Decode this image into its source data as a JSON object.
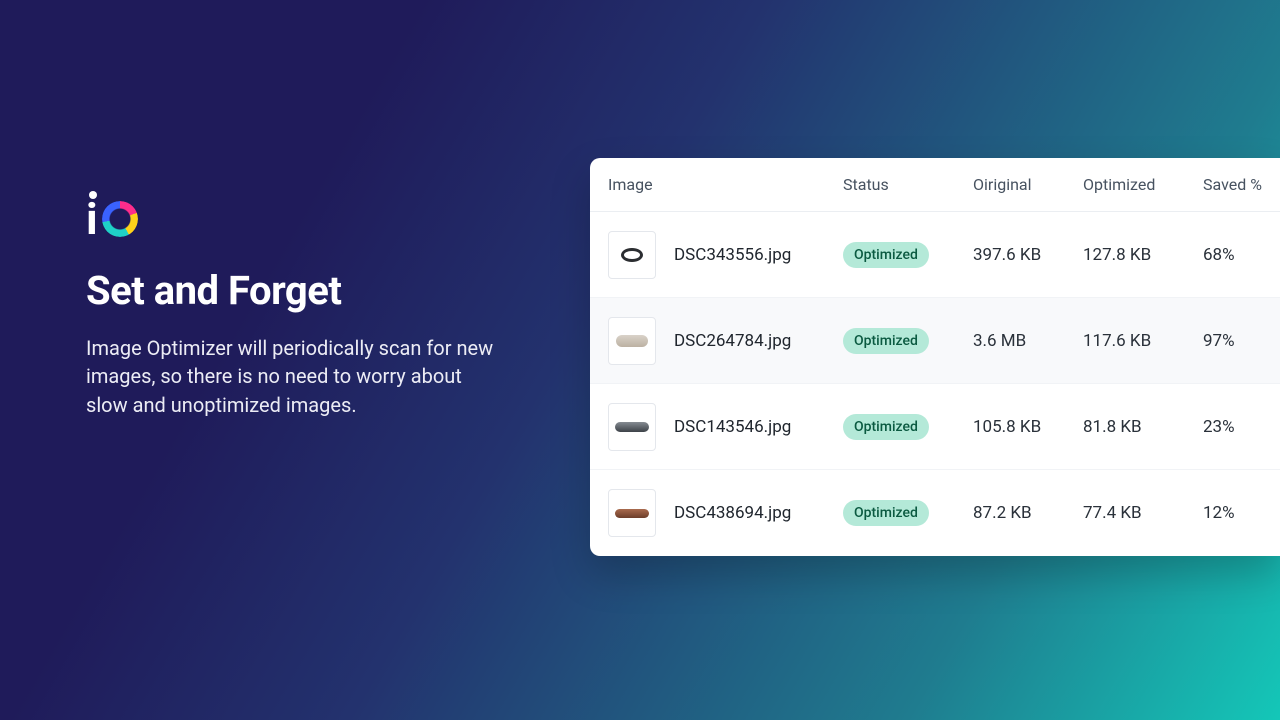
{
  "hero": {
    "headline": "Set and Forget",
    "subtext": "Image Optimizer will periodically scan for new images, so there is no need to worry about slow and unoptimized images."
  },
  "table": {
    "headers": {
      "image": "Image",
      "status": "Status",
      "original": "Oiriginal",
      "optimized": "Optimized",
      "saved": "Saved %"
    },
    "rows": [
      {
        "filename": "DSC343556.jpg",
        "status": "Optimized",
        "original": "397.6 KB",
        "optimized": "127.8 KB",
        "saved": "68%"
      },
      {
        "filename": "DSC264784.jpg",
        "status": "Optimized",
        "original": "3.6 MB",
        "optimized": "117.6 KB",
        "saved": "97%"
      },
      {
        "filename": "DSC143546.jpg",
        "status": "Optimized",
        "original": "105.8 KB",
        "optimized": "81.8 KB",
        "saved": "23%"
      },
      {
        "filename": "DSC438694.jpg",
        "status": "Optimized",
        "original": "87.2 KB",
        "optimized": "77.4 KB",
        "saved": "12%"
      }
    ]
  }
}
